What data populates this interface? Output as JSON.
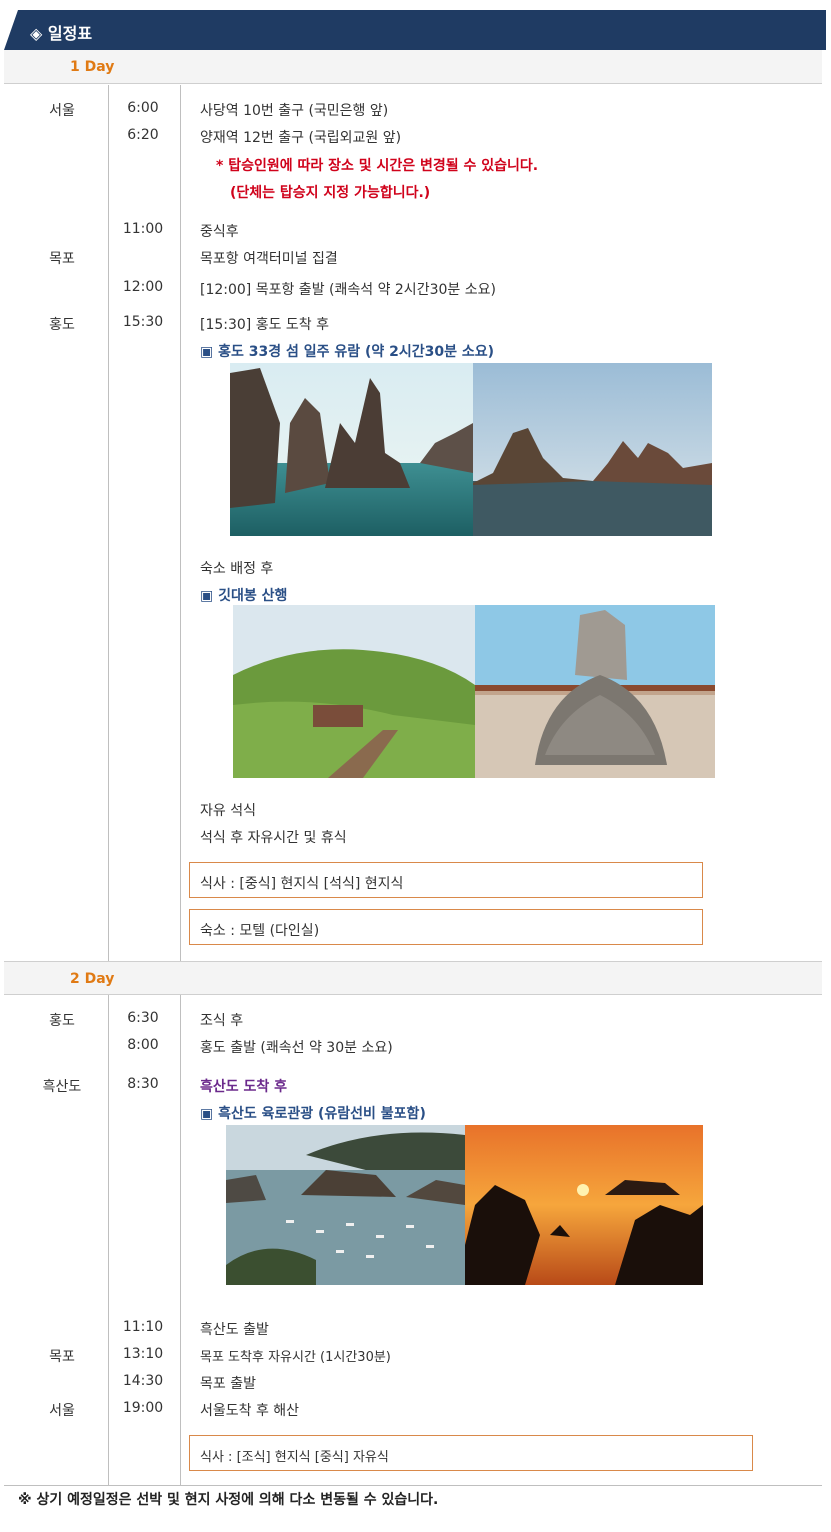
{
  "header": {
    "title": "◈ 일정표"
  },
  "day1": {
    "label": "1 Day",
    "rows": {
      "seoul": "서울",
      "t600": "6:00",
      "r1": "사당역 10번 출구 (국민은행 앞)",
      "t620": "6:20",
      "r2": "양재역 12번 출구 (국립외교원 앞)",
      "note1": "* 탑승인원에 따라 장소 및 시간은 변경될 수 있습니다.",
      "note2": "(단체는 탑승지 지정 가능합니다.)",
      "t1100": "11:00",
      "r3": "중식후",
      "mokpo": "목포",
      "r4": "목포항 여객터미널 집결",
      "t1200": "12:00",
      "r5": "[12:00] 목포항 출발 (쾌속석 약 2시간30분 소요)",
      "hongdo": "홍도",
      "t1530": "15:30",
      "r6": "[15:30] 홍도 도착 후",
      "r7": "▣ 홍도 33경 섬 일주 유람 (약 2시간30분 소요)",
      "r8": "숙소 배정 후",
      "r9": "▣ 깃대봉 산행",
      "r10": "자유 석식",
      "r11": "석식 후 자유시간 및 휴식"
    },
    "meals": "식사 : [중식] 현지식     [석식] 현지식",
    "lodging": "숙소 : 모텔 (다인실)"
  },
  "day2": {
    "label": "2 Day",
    "rows": {
      "hongdo": "홍도",
      "t630": "6:30",
      "r1": "조식 후",
      "t800": "8:00",
      "r2": "홍도 출발 (쾌속선 약 30분 소요)",
      "heuksan": "흑산도",
      "t830": "8:30",
      "r3": "흑산도 도착 후",
      "r4": "▣ 흑산도 육로관광 (유람선비 불포함)",
      "t1110": "11:10",
      "r5": "흑산도 출발",
      "mokpo": "목포",
      "t1310": "13:10",
      "r6": "목포 도착후 자유시간 (1시간30분)",
      "t1430": "14:30",
      "r7": "목포 출발",
      "seoul": "서울",
      "t1900": "19:00",
      "r8": "서울도착 후 해산"
    },
    "meals": "식사 : [조식] 현지식    [중식]  자유식"
  },
  "footer": "※ 상기 예정일정은 선박 및 현지 사정에 의해 다소 변동될 수 있습니다.",
  "icons": {
    "photo1": "sea-rocks-photo",
    "photo2": "coast-photo",
    "photo3": "hill-trail-photo",
    "photo4": "summit-stone-photo",
    "photo5": "harbor-photo",
    "photo6": "sunset-photo"
  }
}
